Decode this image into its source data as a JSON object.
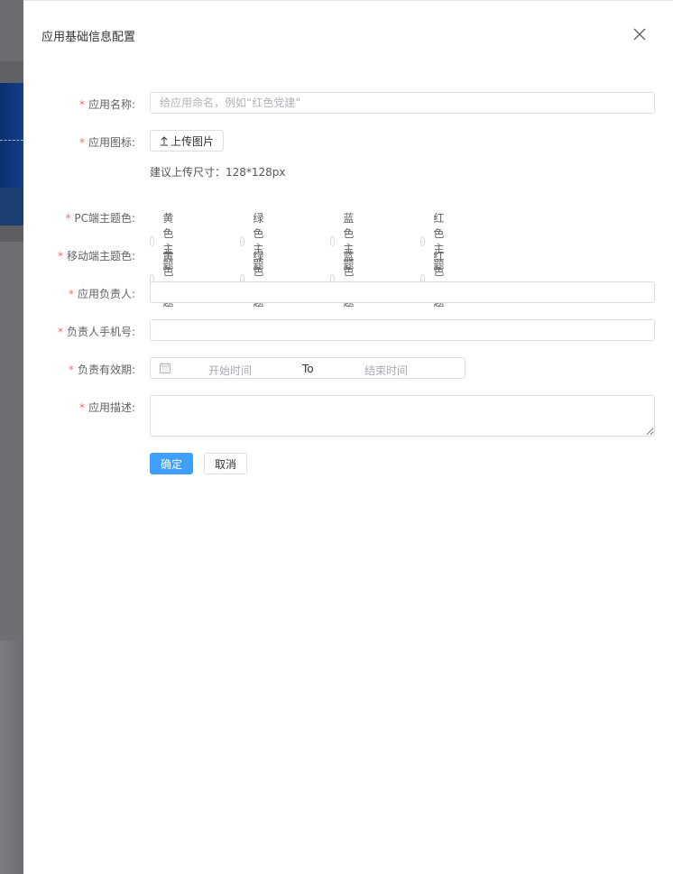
{
  "drawer": {
    "title": "应用基础信息配置",
    "close_icon": "close-icon"
  },
  "form": {
    "required_mark": "*",
    "app_name": {
      "label": "应用名称:",
      "placeholder": "给应用命名，例如“红色党建”",
      "value": ""
    },
    "app_icon": {
      "label": "应用图标:",
      "upload_label": "上传图片",
      "upload_icon": "upload-icon",
      "hint": "建议上传尺寸：128*128px"
    },
    "pc_theme": {
      "label": "PC端主题色:",
      "options": [
        "黄色主题",
        "绿色主题",
        "蓝色主题",
        "红色主题"
      ]
    },
    "mobile_theme": {
      "label": "移动端主题色:",
      "options": [
        "黄色主题",
        "绿色主题",
        "蓝色主题",
        "红色主题"
      ]
    },
    "owner": {
      "label": "应用负责人:",
      "value": ""
    },
    "owner_phone": {
      "label": "负责人手机号:",
      "value": ""
    },
    "validity": {
      "label": "负责有效期:",
      "start_placeholder": "开始时间",
      "separator": "To",
      "end_placeholder": "结束时间",
      "icon": "calendar-icon"
    },
    "description": {
      "label": "应用描述:",
      "value": ""
    },
    "buttons": {
      "confirm": "确定",
      "cancel": "取消"
    }
  },
  "colors": {
    "primary": "#409eff",
    "required": "#f56c6c",
    "border": "#dcdfe6"
  }
}
